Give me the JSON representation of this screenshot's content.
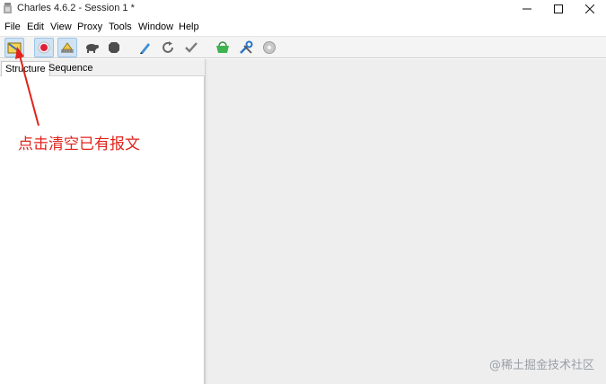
{
  "window": {
    "title": "Charles 4.6.2 - Session 1 *",
    "controls": [
      "minimize-icon",
      "maximize-icon",
      "close-icon"
    ]
  },
  "menu": {
    "items": [
      "File",
      "Edit",
      "View",
      "Proxy",
      "Tools",
      "Window",
      "Help"
    ]
  },
  "toolbar": {
    "buttons": [
      {
        "icon": "broom-clear-icon",
        "tooltip": "Clear the current Session",
        "active": true
      },
      {
        "icon": "record-icon",
        "tooltip": "Start/Stop Recording",
        "active": true
      },
      {
        "icon": "throttle-icon",
        "tooltip": "Throttling",
        "active": true
      },
      {
        "icon": "turtle-icon",
        "tooltip": "Throttle"
      },
      {
        "icon": "stop-hexagon-icon",
        "tooltip": "Breakpoints"
      },
      {
        "icon": "pen-icon",
        "tooltip": "Compose"
      },
      {
        "icon": "repeat-icon",
        "tooltip": "Repeat"
      },
      {
        "icon": "check-icon",
        "tooltip": "Validate"
      },
      {
        "icon": "basket-icon",
        "tooltip": "Tools"
      },
      {
        "icon": "wrench-icon",
        "tooltip": "Settings"
      },
      {
        "icon": "gear-icon",
        "tooltip": "Preferences"
      }
    ]
  },
  "tabs": {
    "structure": "Structure",
    "sequence": "Sequence"
  },
  "annotation": {
    "text": "点击清空已有报文",
    "color": "#e0231b"
  },
  "watermark": "@稀土掘金技术社区"
}
